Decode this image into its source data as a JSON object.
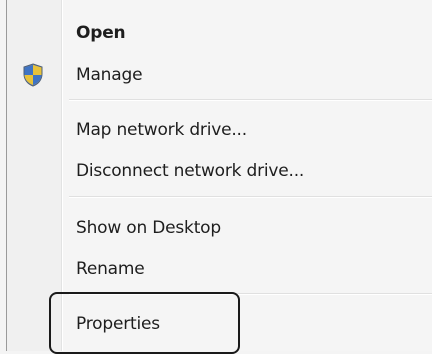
{
  "context_menu": {
    "items": [
      {
        "label": "Open",
        "bold": true
      },
      {
        "label": "Manage",
        "icon": "uac-shield-icon"
      },
      {
        "label": "Map network drive..."
      },
      {
        "label": "Disconnect network drive..."
      },
      {
        "label": "Show on Desktop"
      },
      {
        "label": "Rename"
      },
      {
        "label": "Properties"
      }
    ]
  }
}
